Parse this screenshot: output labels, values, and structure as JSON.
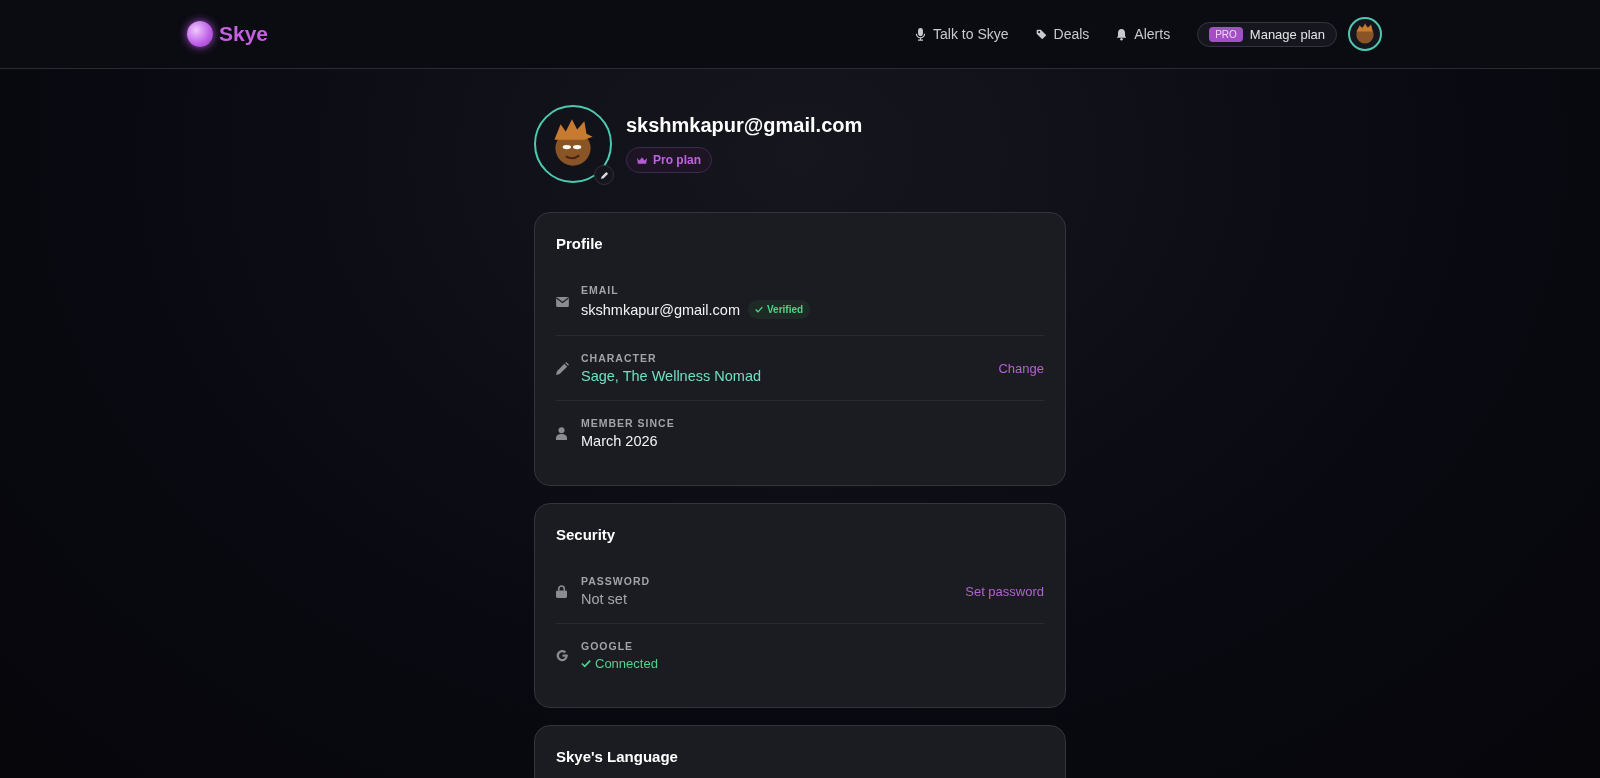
{
  "header": {
    "brand": "Skye",
    "nav": [
      {
        "label": "Talk to Skye"
      },
      {
        "label": "Deals"
      },
      {
        "label": "Alerts"
      }
    ],
    "plan_button": {
      "badge": "PRO",
      "label": "Manage plan"
    }
  },
  "profile": {
    "email": "skshmkapur@gmail.com",
    "plan": "Pro plan"
  },
  "sections": [
    {
      "title": "Profile",
      "rows": [
        {
          "label": "EMAIL",
          "value": "skshmkapur@gmail.com",
          "kind": "plain",
          "badge": "Verified"
        },
        {
          "label": "CHARACTER",
          "value": "Sage, The Wellness Nomad",
          "kind": "accent",
          "action": "Change"
        },
        {
          "label": "MEMBER SINCE",
          "value": "March 2026",
          "kind": "plain"
        }
      ]
    },
    {
      "title": "Security",
      "rows": [
        {
          "label": "PASSWORD",
          "value": "Not set",
          "kind": "muted",
          "action": "Set password"
        },
        {
          "label": "GOOGLE",
          "value": "Connected",
          "kind": "status"
        }
      ]
    },
    {
      "title": "Skye's Language"
    }
  ]
}
